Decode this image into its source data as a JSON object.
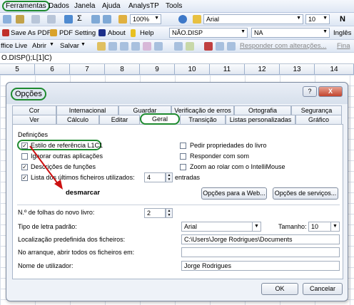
{
  "menubar": {
    "items": [
      "Ferramentas",
      "Dados",
      "Janela",
      "Ajuda",
      "AnalysTP",
      "Tools"
    ]
  },
  "toolbar1": {
    "zoom": "100%",
    "font": "Arial",
    "size": "10",
    "bold": "N"
  },
  "toolbar2": {
    "save_pdf": "Save As PDF",
    "pdf_setting": "PDF Setting",
    "about": "About",
    "help": "Help",
    "combo1": "NÃO.DISP",
    "combo2": "NA",
    "lang": "Inglês"
  },
  "toolbar3": {
    "office_live": "ffice Live",
    "abrir": "Abrir",
    "salvar": "Salvar",
    "responder": "Responder com alterações...",
    "fina": "Fina"
  },
  "formula_bar": {
    "text": "O.DISP();L[1]C)"
  },
  "columns": [
    "5",
    "6",
    "7",
    "8",
    "9",
    "10",
    "11",
    "12",
    "13",
    "14"
  ],
  "dialog": {
    "title": "Opções",
    "help_button": "?",
    "close_button": "X",
    "tabs_top": [
      "Cor",
      "Internacional",
      "Guardar",
      "Verificação de erros",
      "Ortografia",
      "Segurança"
    ],
    "tabs_bottom": [
      "Ver",
      "Cálculo",
      "Editar",
      "Geral",
      "Transição",
      "Listas personalizadas",
      "Gráfico"
    ],
    "active_tab": "Geral",
    "section_title": "Definições",
    "left_options": [
      {
        "label": "Estilo de referência L1C1",
        "checked": true
      },
      {
        "label": "Ignorar outras aplicações",
        "checked": false
      },
      {
        "label": "Descrições de funções",
        "checked": true
      },
      {
        "label": "Lista dos últimos ficheiros utilizados:",
        "checked": true
      }
    ],
    "recent_files_count": "4",
    "recent_files_suffix": "entradas",
    "right_options": [
      {
        "label": "Pedir propriedades do livro",
        "checked": false
      },
      {
        "label": "Responder com som",
        "checked": false
      },
      {
        "label": "Zoom ao rolar com o IntelliMouse",
        "checked": false
      }
    ],
    "annotation": "desmarcar",
    "web_options_button": "Opções para a Web...",
    "service_options_button": "Opções de serviços...",
    "sheets_label": "N.º de folhas do novo livro:",
    "sheets_value": "2",
    "font_label": "Tipo de letra padrão:",
    "font_value": "Arial",
    "size_label": "Tamanho:",
    "size_value": "10",
    "location_label": "Localização predefinida dos ficheiros:",
    "location_value": "C:\\Users\\Jorge Rodrigues\\Documents",
    "startup_label": "No arranque, abrir todos os ficheiros em:",
    "startup_value": "",
    "username_label": "Nome de utilizador:",
    "username_value": "Jorge Rodrigues",
    "ok_button": "OK",
    "cancel_button": "Cancelar"
  },
  "colors": {
    "highlight": "#1e8a2f",
    "arrow": "#cc1111"
  }
}
